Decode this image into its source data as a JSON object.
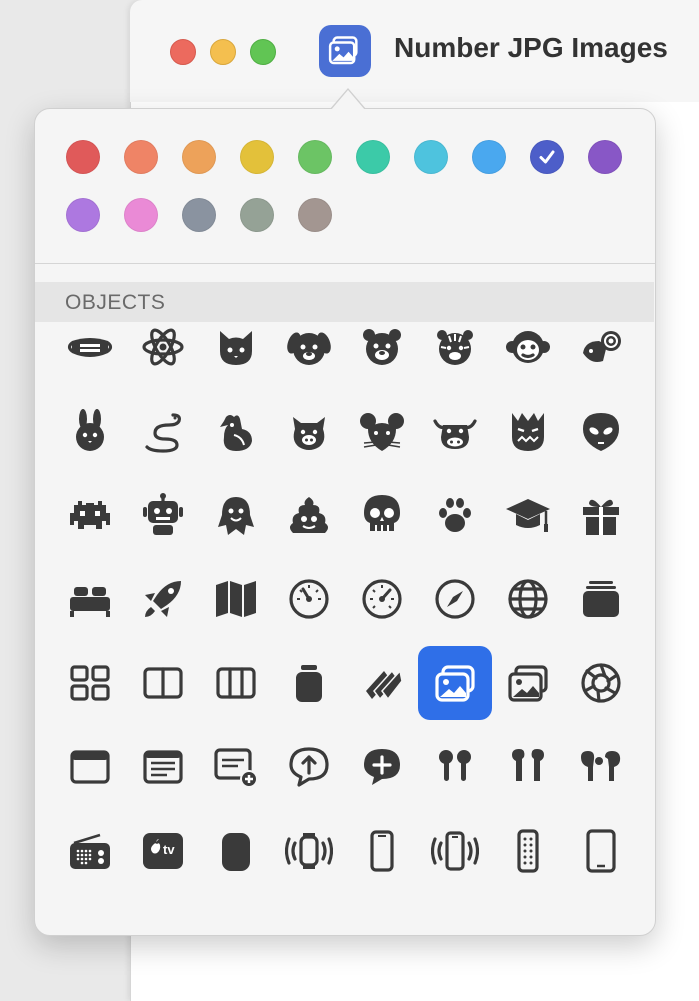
{
  "window": {
    "title": "Number JPG Images"
  },
  "popover": {
    "section_title": "OBJECTS",
    "colors": [
      {
        "name": "red",
        "hex": "#e05a5a"
      },
      {
        "name": "coral",
        "hex": "#ef8466"
      },
      {
        "name": "orange",
        "hex": "#eda25a"
      },
      {
        "name": "yellow",
        "hex": "#e3c13a"
      },
      {
        "name": "green",
        "hex": "#6cc465"
      },
      {
        "name": "teal",
        "hex": "#3ccaa8"
      },
      {
        "name": "cyan",
        "hex": "#4ec3de"
      },
      {
        "name": "blue",
        "hex": "#4aa8ef"
      },
      {
        "name": "indigo",
        "hex": "#4d5ec9",
        "selected": true
      },
      {
        "name": "purple",
        "hex": "#8857c6"
      },
      {
        "name": "lavender",
        "hex": "#ad78e0"
      },
      {
        "name": "pink",
        "hex": "#ea8ad6"
      },
      {
        "name": "slate",
        "hex": "#8a93a0"
      },
      {
        "name": "sage",
        "hex": "#95a296"
      },
      {
        "name": "taupe",
        "hex": "#a39691"
      }
    ],
    "selected_icon": "photo-stack-icon",
    "icons": [
      "face-mask-icon",
      "atom-icon",
      "cat-face-icon",
      "dog-face-icon",
      "bear-face-icon",
      "tiger-face-icon",
      "monkey-face-icon",
      "ram-icon",
      "rabbit-face-icon",
      "snake-icon",
      "rooster-icon",
      "pig-face-icon",
      "rat-face-icon",
      "ox-face-icon",
      "dragon-face-icon",
      "alien-face-icon",
      "space-invader-icon",
      "robot-icon",
      "ghost-icon",
      "poo-icon",
      "skull-icon",
      "paw-print-icon",
      "graduation-cap-icon",
      "gift-icon",
      "bed-icon",
      "rocket-icon",
      "map-icon",
      "gauge-low-icon",
      "gauge-high-icon",
      "compass-icon",
      "globe-icon",
      "stack-icon",
      "grid-2x2-icon",
      "columns-2-icon",
      "columns-3-icon",
      "jar-icon",
      "card-stack-icon",
      "photo-stack-icon",
      "photos-icon",
      "camera-aperture-icon",
      "window-icon",
      "text-window-icon",
      "add-window-icon",
      "share-bubble-icon",
      "add-bubble-icon",
      "earbuds-icon",
      "earbuds-pro-icon",
      "earbuds-max-icon",
      "radio-icon",
      "apple-tv-icon",
      "homepod-icon",
      "watch-waves-icon",
      "phone-icon",
      "phone-waves-icon",
      "remote-icon",
      "tablet-icon"
    ],
    "apple_tv_label": "tv"
  }
}
